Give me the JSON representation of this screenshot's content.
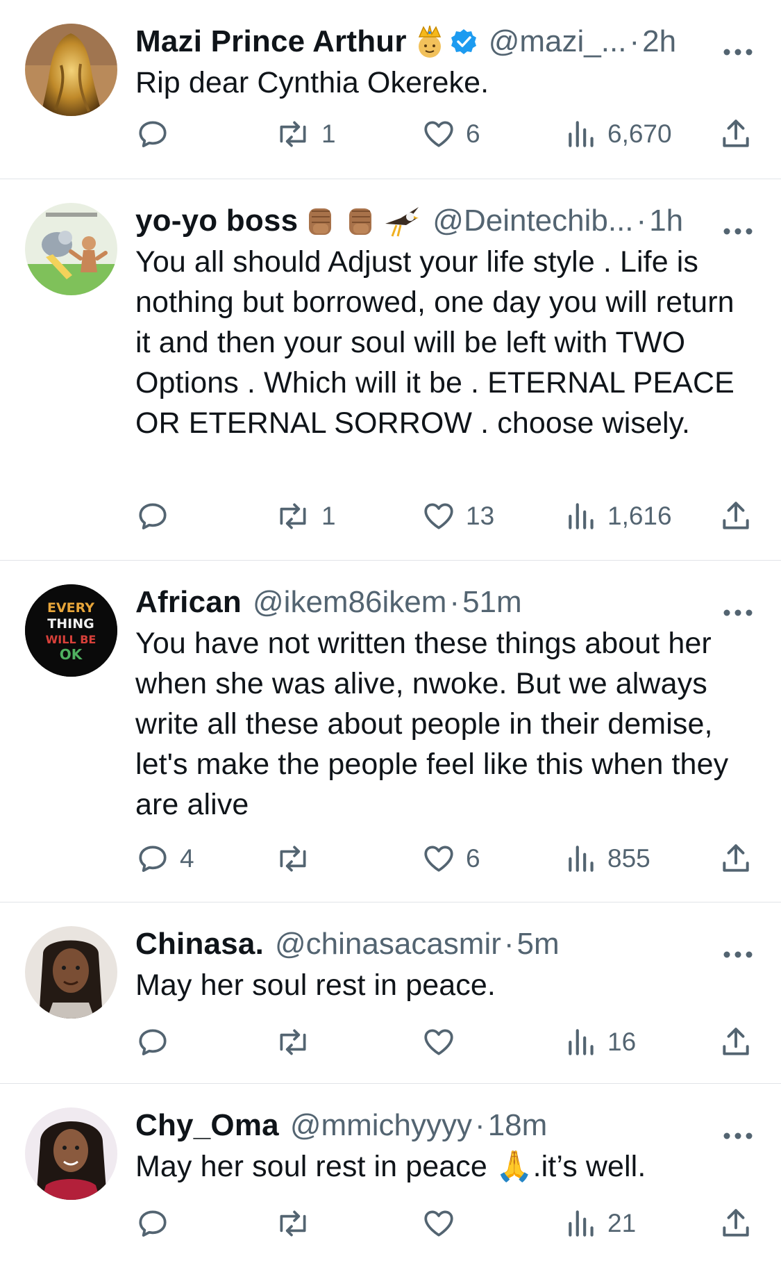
{
  "tweets": [
    {
      "name": "Mazi Prince Arthur",
      "badges": [
        "crown-emoji",
        "verified-badge"
      ],
      "handle": "@mazi_...",
      "time": "2h",
      "text": "Rip dear Cynthia Okereke.",
      "replies": "",
      "retweets": "1",
      "likes": "6",
      "views": "6,670"
    },
    {
      "name": "yo-yo boss",
      "badges": [
        "raised-fist-emoji",
        "raised-fist-emoji",
        "eagle-emoji"
      ],
      "handle": "@Deintechib...",
      "time": "1h",
      "text": "You all should Adjust your life style . Life is nothing but borrowed, one day you will return it and then your soul will be left with TWO Options . Which will it be . ETERNAL PEACE OR ETERNAL SORROW . choose wisely.",
      "replies": "",
      "retweets": "1",
      "likes": "13",
      "views": "1,616"
    },
    {
      "name": "African",
      "badges": [],
      "handle": "@ikem86ikem",
      "time": "51m",
      "text": "You have not written these things about her when she was alive, nwoke. But we always write all these about people in their demise, let's make the people feel like this when they are alive",
      "replies": "4",
      "retweets": "",
      "likes": "6",
      "views": "855",
      "avatar_text": [
        "EVERY",
        "THING",
        "WILL BE",
        "OK"
      ]
    },
    {
      "name": "Chinasa.",
      "badges": [],
      "handle": "@chinasacasmir",
      "time": "5m",
      "text": "May her soul rest in peace.",
      "replies": "",
      "retweets": "",
      "likes": "",
      "views": "16"
    },
    {
      "name": "Chy_Oma",
      "badges": [],
      "handle": "@mmichyyyy",
      "time": "18m",
      "text": "May her soul rest in peace 🙏.it’s well.",
      "replies": "",
      "retweets": "",
      "likes": "",
      "views": "21"
    }
  ],
  "separator": "·",
  "colors": {
    "text": "#0f1419",
    "secondary": "#536471",
    "verified": "#1d9bf0",
    "divider": "#e1e4e8"
  },
  "icons": {
    "reply": "speech-bubble-icon",
    "retweet": "retweet-arrows-icon",
    "like": "heart-icon",
    "views": "bar-chart-icon",
    "share": "share-upload-icon",
    "more": "ellipsis-icon"
  }
}
